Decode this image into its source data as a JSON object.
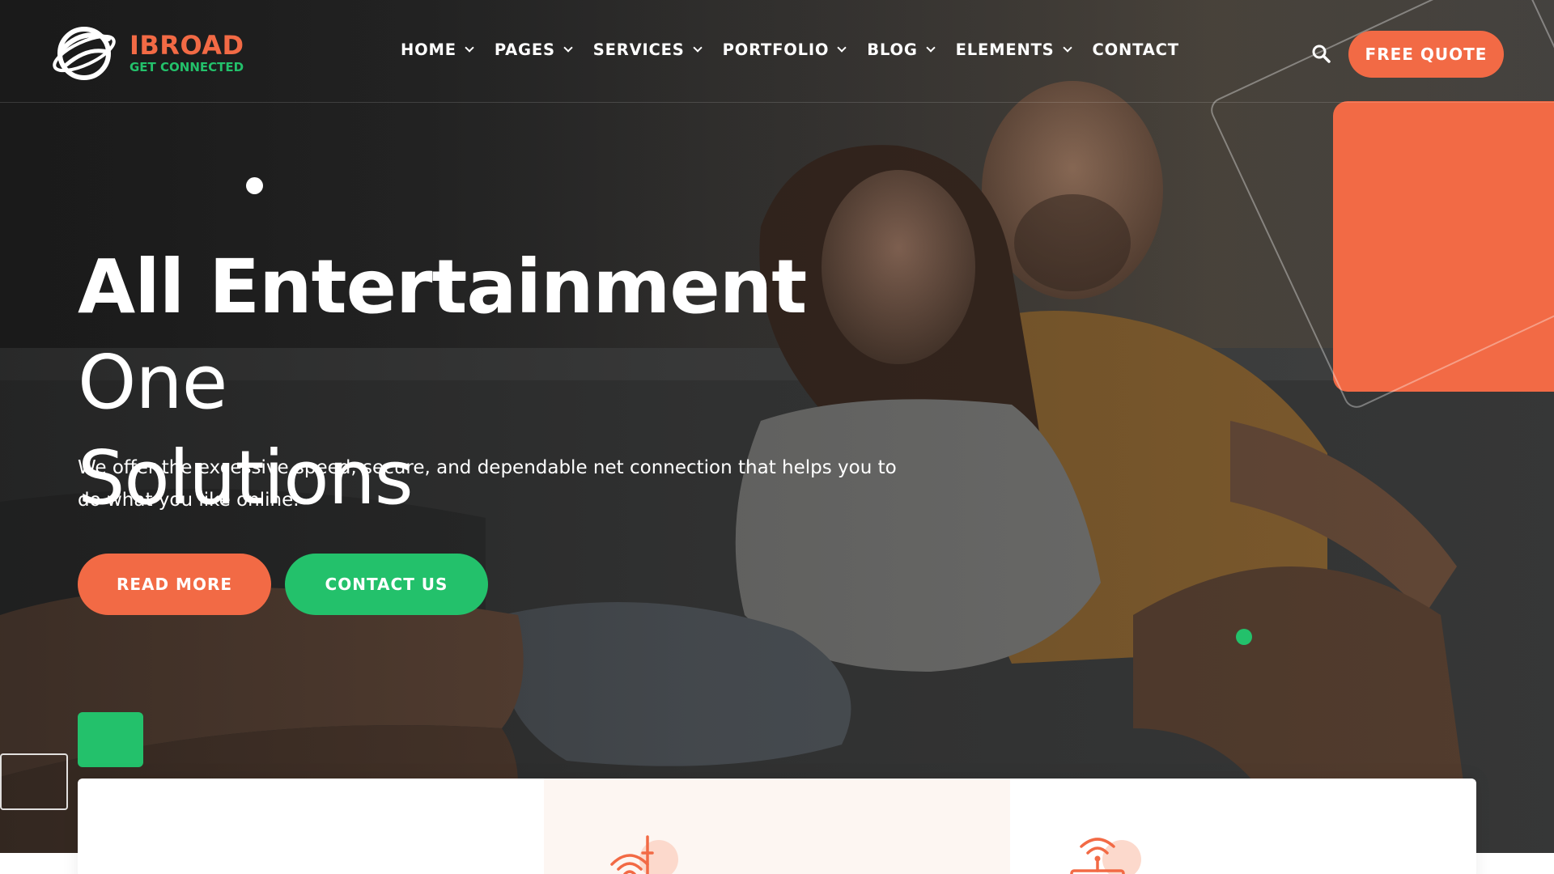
{
  "colors": {
    "accent_orange": "#f26a45",
    "accent_green": "#23c16b",
    "header_text": "#ffffff"
  },
  "logo": {
    "name": "IBROAD",
    "tagline": "GET CONNECTED",
    "icon": "globe-ring-icon"
  },
  "nav": {
    "items": [
      {
        "label": "HOME",
        "has_dropdown": true
      },
      {
        "label": "PAGES",
        "has_dropdown": true
      },
      {
        "label": "SERVICES",
        "has_dropdown": true
      },
      {
        "label": "PORTFOLIO",
        "has_dropdown": true
      },
      {
        "label": "BLOG",
        "has_dropdown": true
      },
      {
        "label": "ELEMENTS",
        "has_dropdown": true
      },
      {
        "label": "CONTACT",
        "has_dropdown": false
      }
    ],
    "search_icon": "search-icon",
    "cta_label": "FREE QUOTE"
  },
  "hero": {
    "title_bold": "All Entertainment",
    "title_light_1": "One",
    "title_light_2": "Solutions",
    "description": "We offer the excessive speed, secure, and dependable net connection that helps you to do what you like online.",
    "primary_button": "READ MORE",
    "secondary_button": "CONTACT US"
  },
  "features": {
    "icons": [
      "router-icon",
      "wifi-router-icon"
    ]
  }
}
